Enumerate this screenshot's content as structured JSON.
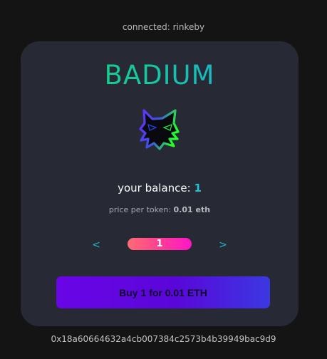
{
  "header": {
    "network_status": "connected: rinkeby"
  },
  "card": {
    "brand": "BADIUM",
    "logo_icon": "cat-head-icon",
    "balance_label": "your balance: ",
    "balance_value": "1",
    "price_label": "price per token: ",
    "price_value": "0.01 eth",
    "stepper": {
      "decrement_label": "<",
      "increment_label": ">",
      "quantity": "1"
    },
    "buy_label": "Buy 1 for 0.01 ETH"
  },
  "footer": {
    "wallet_address": "0x18a60664632a4cb007384c2573b4b39949bac9d9"
  },
  "colors": {
    "background": "#141414",
    "card": "#272a35",
    "accent_cyan": "#22c3d6",
    "button_purple": "#6a05e6",
    "stepper_pink": "#ff3a98"
  }
}
